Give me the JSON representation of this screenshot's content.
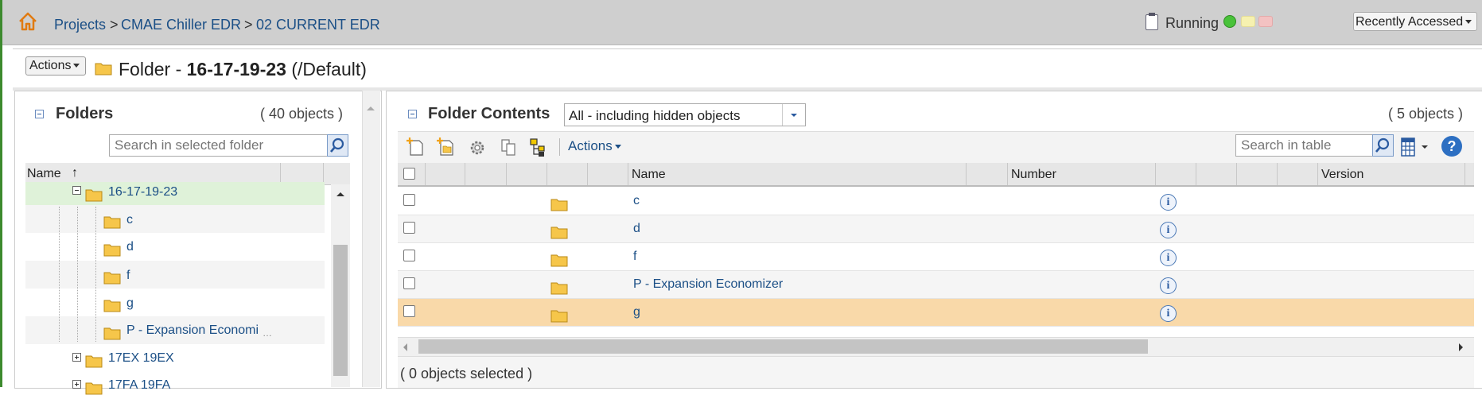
{
  "breadcrumb": {
    "items": [
      "Projects",
      "CMAE Chiller EDR",
      "02 CURRENT EDR"
    ],
    "separators": [
      ">",
      ">"
    ]
  },
  "status": {
    "label": "Running",
    "lights": [
      "#49c23a",
      "#f6f1b0",
      "#f3c2c2"
    ]
  },
  "recently_accessed": {
    "label": "Recently Accessed"
  },
  "header": {
    "actions_label": "Actions",
    "title_prefix": "Folder - ",
    "title_name": "16-17-19-23",
    "title_suffix": " (/Default)"
  },
  "folders_panel": {
    "title": "Folders",
    "count": "( 40 objects )",
    "search_placeholder": "Search in selected folder",
    "column_name": "Name",
    "sort_indicator": "↑",
    "tree": [
      {
        "label": "16-17-19-23",
        "expander": "minus",
        "level": 0,
        "selected": true
      },
      {
        "label": "c",
        "level": 1
      },
      {
        "label": "d",
        "level": 1
      },
      {
        "label": "f",
        "level": 1
      },
      {
        "label": "g",
        "level": 1
      },
      {
        "label": "P - Expansion Economi",
        "level": 1
      },
      {
        "label": "17EX 19EX",
        "expander": "plus",
        "level": 0
      },
      {
        "label": "17FA 19FA",
        "expander": "plus",
        "level": 0
      }
    ]
  },
  "contents_panel": {
    "title": "Folder Contents",
    "filter_value": "All - including hidden objects",
    "count": "( 5 objects )",
    "toolbar_actions_label": "Actions",
    "search_placeholder": "Search in table",
    "help_label": "?",
    "columns": {
      "name": "Name",
      "number": "Number",
      "version": "Version"
    },
    "rows": [
      {
        "name": "c",
        "selected": false
      },
      {
        "name": "d",
        "selected": false
      },
      {
        "name": "f",
        "selected": false
      },
      {
        "name": "P - Expansion Economizer",
        "selected": false
      },
      {
        "name": "g",
        "selected": true
      }
    ],
    "info_label": "i",
    "selection_status": "( 0 objects selected )"
  },
  "colors": {
    "link": "#1b4f86",
    "selected_row": "#f9d9a9",
    "tree_selected": "#dff2d9",
    "accent_stripe": "#3d8a2e"
  }
}
